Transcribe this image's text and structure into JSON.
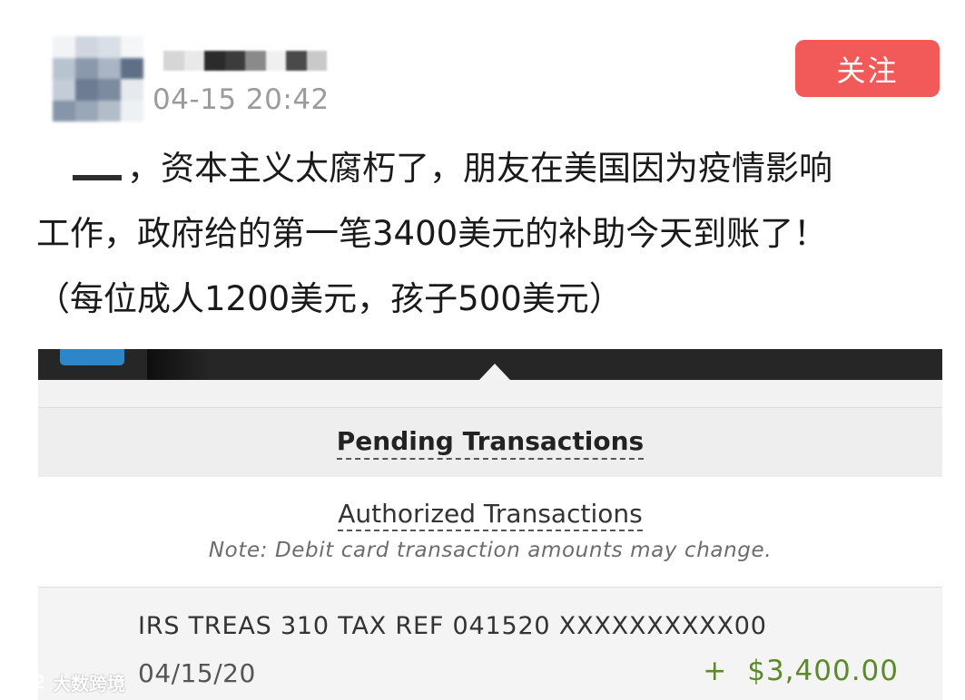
{
  "post": {
    "time": "04-15 20:42",
    "follow_label": "关注",
    "text_line1": "，资本主义太腐朽了，朋友在美国因为疫情影响",
    "text_line2": "工作，政府给的第一笔3400美元的补助今天到账了！",
    "text_line3": "（每位成人1200美元，孩子500美元）"
  },
  "bank": {
    "pending_title": "Pending Transactions",
    "authorized_title": "Authorized Transactions",
    "note": "Note: Debit card transaction amounts may change.",
    "transaction": {
      "description": "IRS TREAS 310 TAX REF 041520 XXXXXXXXXX00",
      "date": "04/15/20",
      "sign": "+",
      "amount": "$3,400.00"
    },
    "colors": {
      "topbar": "#262626",
      "menu_button": "#2e86c9",
      "amount_positive": "#5c8a2b"
    }
  },
  "theme": {
    "follow_button_color": "#f25a5a"
  },
  "watermark": {
    "text": "大数跨境",
    "icon": "logo-icon"
  }
}
